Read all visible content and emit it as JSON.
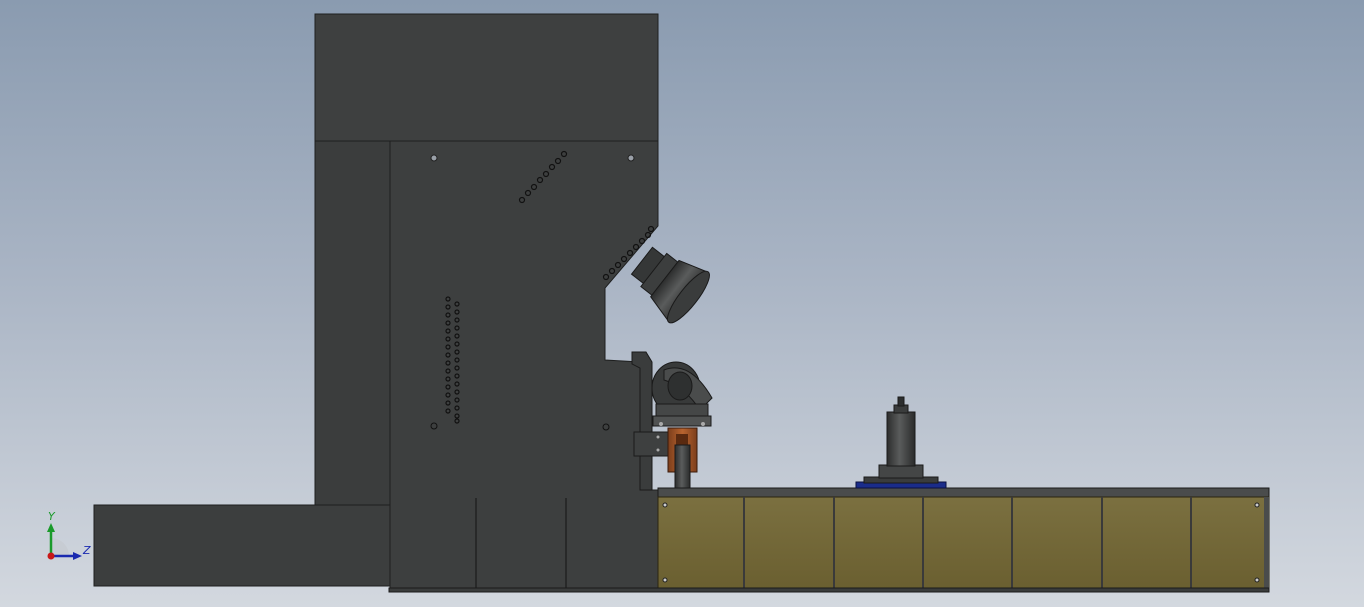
{
  "viewport": {
    "background_top": "#8a9bb0",
    "background_bottom": "#d3d8df"
  },
  "colors": {
    "machine_body": "#3d3f3f",
    "machine_edge": "#1e1f1f",
    "panel_olive": "#756a37",
    "copper": "#a8572a",
    "blue_plate": "#1a2c8a",
    "axis_y": "#1a9a2a",
    "axis_z": "#1a2ab0",
    "axis_origin": "#c81818"
  },
  "triad": {
    "y_label": "Y",
    "z_label": "Z",
    "icon": "coordinate-triad-icon"
  }
}
